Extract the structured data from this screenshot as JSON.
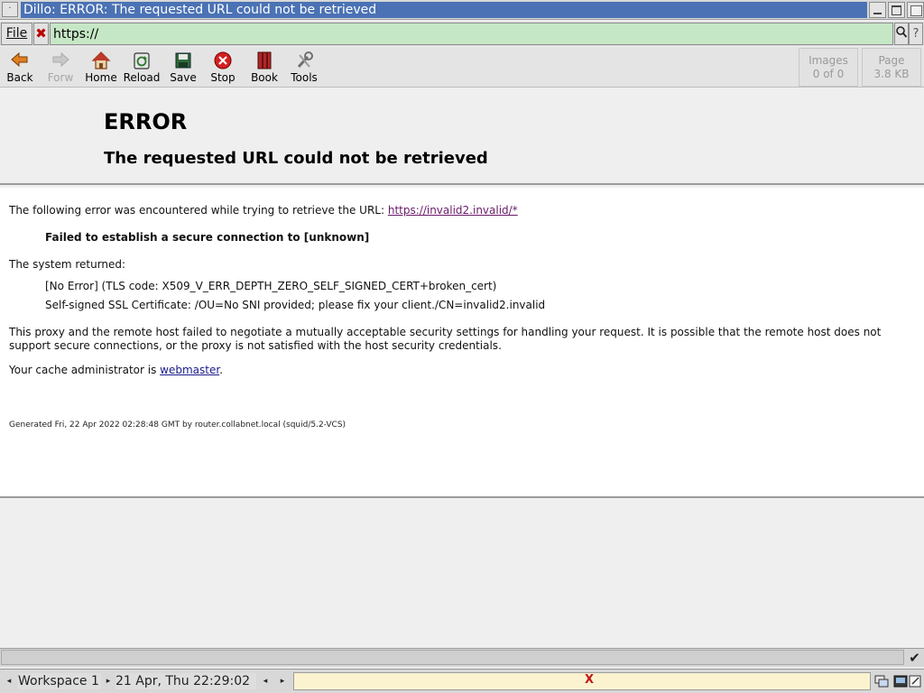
{
  "window": {
    "title": "Dillo: ERROR: The requested URL could not be retrieved",
    "menu_glyph": "·"
  },
  "location": {
    "file_label": "File",
    "url_value": "https://",
    "help_glyph": "?"
  },
  "toolbar": {
    "back": "Back",
    "forw": "Forw",
    "home": "Home",
    "reload": "Reload",
    "save": "Save",
    "stop": "Stop",
    "book": "Book",
    "tools": "Tools",
    "images_label": "Images",
    "images_value": "0 of 0",
    "page_label": "Page",
    "page_value": "3.8 KB"
  },
  "page": {
    "heading": "ERROR",
    "subheading": "The requested URL could not be retrieved",
    "intro": "The following error was encountered while trying to retrieve the URL: ",
    "url_link": "https://invalid2.invalid/*",
    "error_title": "Failed to establish a secure connection to [unknown]",
    "system_returned": "The system returned:",
    "tls_line": "[No Error] (TLS code: X509_V_ERR_DEPTH_ZERO_SELF_SIGNED_CERT+broken_cert)",
    "cert_line": "Self-signed SSL Certificate: /OU=No SNI provided; please fix your client./CN=invalid2.invalid",
    "explanation": "This proxy and the remote host failed to negotiate a mutually acceptable security settings for handling your request. It is possible that the remote host does not support secure connections, or the proxy is not satisfied with the host security credentials.",
    "admin_prefix": "Your cache administrator is ",
    "admin_link": "webmaster",
    "admin_suffix": ".",
    "footer": "Generated Fri, 22 Apr 2022 02:28:48 GMT by router.collabnet.local (squid/5.2-VCS)"
  },
  "panel": {
    "workspace": "Workspace 1",
    "clock": "21 Apr, Thu 22:29:02",
    "arrow_left": "◂",
    "arrow_right": "▸",
    "tray_x": "X"
  },
  "colors": {
    "title_bg": "#4a72b4",
    "url_bg": "#c6e7c6",
    "taskbar_bg": "#fbf3cf"
  }
}
